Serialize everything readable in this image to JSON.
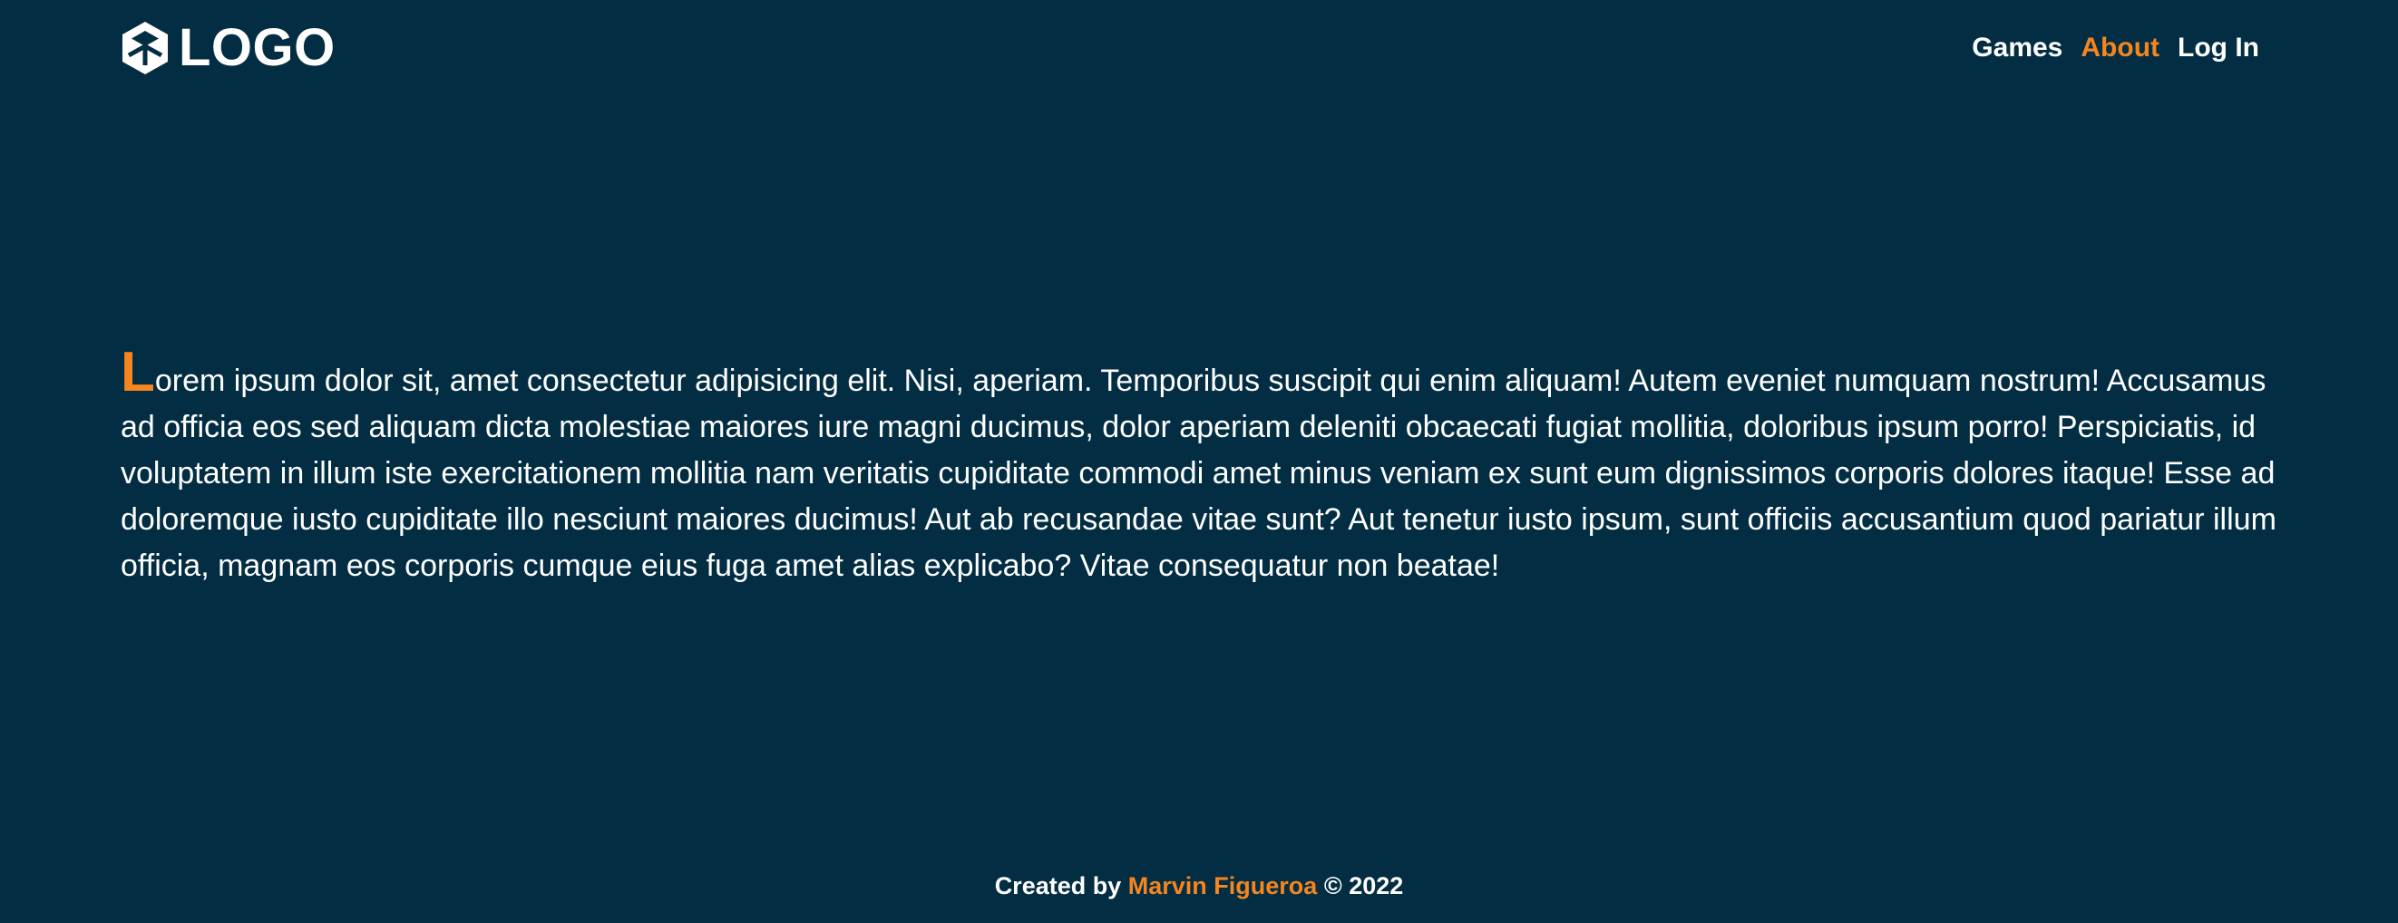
{
  "theme": {
    "background": "#022d43",
    "text": "#ffffff",
    "accent": "#f5861f"
  },
  "header": {
    "logo": {
      "icon": "cube-icon",
      "text": "LOGO"
    },
    "nav": [
      {
        "label": "Games",
        "active": false
      },
      {
        "label": "About",
        "active": true
      },
      {
        "label": "Log In",
        "active": false
      }
    ]
  },
  "main": {
    "dropcap": "L",
    "paragraph_rest": "orem ipsum dolor sit, amet consectetur adipisicing elit. Nisi, aperiam. Temporibus suscipit qui enim aliquam! Autem eveniet numquam nostrum! Accusamus ad officia eos sed aliquam dicta molestiae maiores iure magni ducimus, dolor aperiam deleniti obcaecati fugiat mollitia, doloribus ipsum porro! Perspiciatis, id voluptatem in illum iste exercitationem mollitia nam veritatis cupiditate commodi amet minus veniam ex sunt eum dignissimos corporis dolores itaque! Esse ad doloremque iusto cupiditate illo nesciunt maiores ducimus! Aut ab recusandae vitae sunt? Aut tenetur iusto ipsum, sunt officiis accusantium quod pariatur illum officia, magnam eos corporis cumque eius fuga amet alias explicabo? Vitae consequatur non beatae!"
  },
  "footer": {
    "prefix": "Created by",
    "author": "Marvin Figueroa",
    "suffix": "© 2022"
  }
}
